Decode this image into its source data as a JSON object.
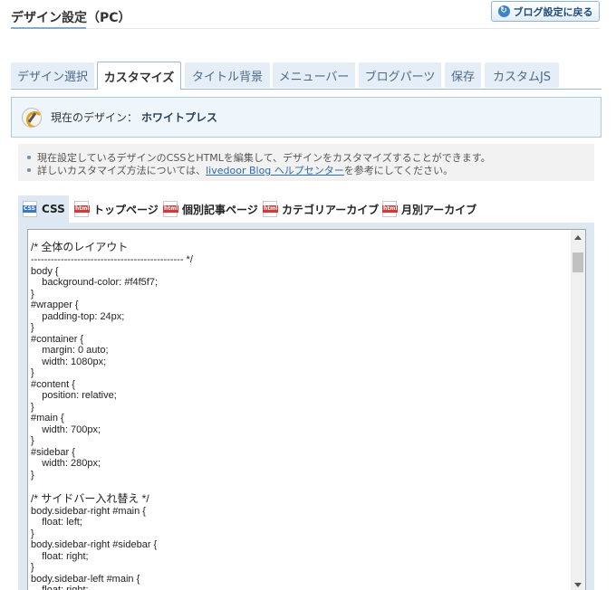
{
  "page": {
    "title": "デザイン設定（PC）",
    "back_button": "ブログ設定に戻る",
    "back_icon": "refresh-arrow-icon"
  },
  "tabs": [
    {
      "label": "デザイン選択",
      "active": false
    },
    {
      "label": "カスタマイズ",
      "active": true
    },
    {
      "label": "タイトル背景",
      "active": false
    },
    {
      "label": "メニューバー",
      "active": false
    },
    {
      "label": "ブログパーツ",
      "active": false
    },
    {
      "label": "保存",
      "active": false
    },
    {
      "label": "カスタムJS",
      "active": false
    }
  ],
  "current_design": {
    "label": "現在のデザイン：",
    "name": "ホワイトプレス"
  },
  "info": {
    "line1": "現在設定しているデザインのCSSとHTMLを編集して、デザインをカスタマイズすることができます。",
    "line2_before": "詳しいカスタマイズ方法については、",
    "line2_link": "livedoor Blog ヘルプセンター",
    "line2_after": "を参考にしてください。"
  },
  "file_tabs": [
    {
      "label": "CSS",
      "icon": "css",
      "active": true
    },
    {
      "label": "トップページ",
      "icon": "html",
      "active": false
    },
    {
      "label": "個別記事ページ",
      "icon": "html",
      "active": false
    },
    {
      "label": "カテゴリアーカイブ",
      "icon": "html",
      "active": false
    },
    {
      "label": "月別アーカイブ",
      "icon": "html",
      "active": false
    }
  ],
  "editor": {
    "lines": [
      "/* 全体のレイアウト",
      "---------------------------------------------- */",
      "body {",
      "    background-color: #f4f5f7;",
      "}",
      "#wrapper {",
      "    padding-top: 24px;",
      "}",
      "#container {",
      "    margin: 0 auto;",
      "    width: 1080px;",
      "}",
      "#content {",
      "    position: relative;",
      "}",
      "#main {",
      "    width: 700px;",
      "}",
      "#sidebar {",
      "    width: 280px;",
      "}",
      "",
      "/* サイドバー入れ替え */",
      "body.sidebar-right #main {",
      "    float: left;",
      "}",
      "body.sidebar-right #sidebar {",
      "    float: right;",
      "}",
      "body.sidebar-left #main {",
      "    float: right;"
    ]
  }
}
